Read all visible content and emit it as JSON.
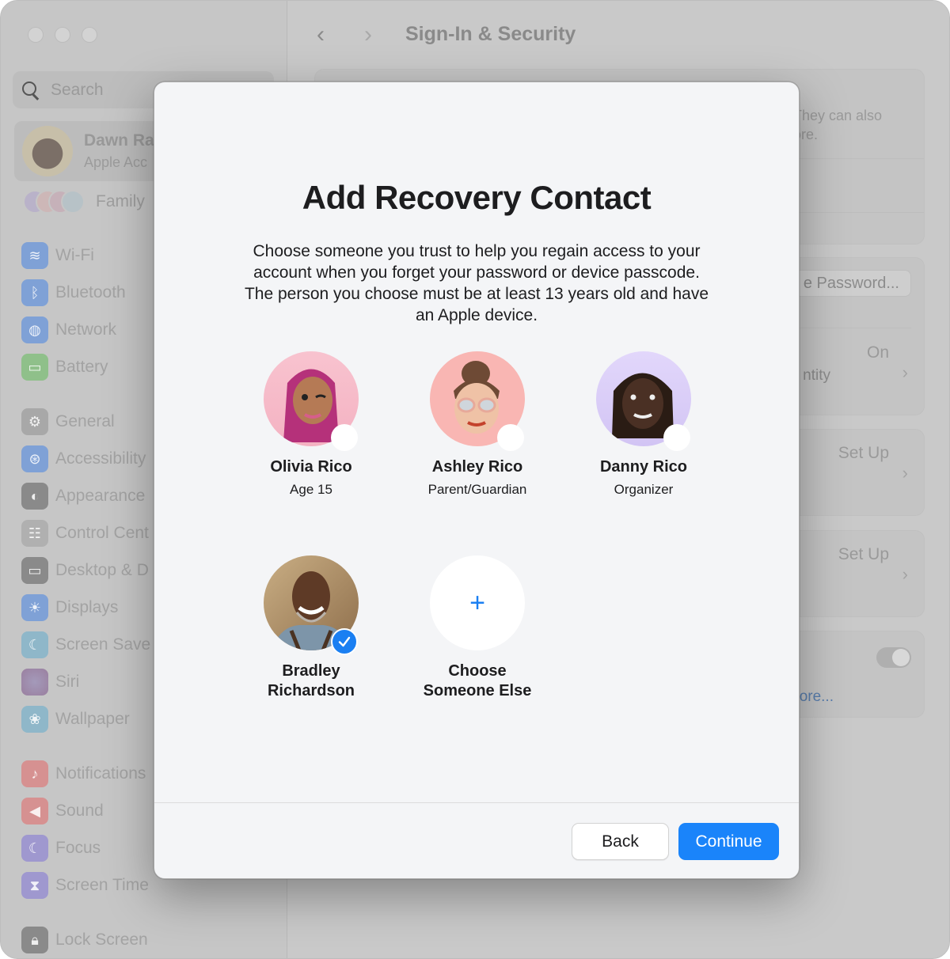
{
  "window": {
    "traffic_lights": [
      "close",
      "minimize",
      "zoom"
    ]
  },
  "sidebar": {
    "search_placeholder": "Search",
    "account": {
      "name": "Dawn Ra",
      "subtitle": "Apple Acc"
    },
    "family_label": "Family",
    "items": [
      {
        "label": "Wi-Fi",
        "icon": "wifi-icon",
        "color": "#7fa1d6"
      },
      {
        "label": "Bluetooth",
        "icon": "bluetooth-icon",
        "color": "#7fa1d6"
      },
      {
        "label": "Network",
        "icon": "globe-icon",
        "color": "#7fa1d6"
      },
      {
        "label": "Battery",
        "icon": "battery-icon",
        "color": "#8fc08a"
      },
      {
        "label": "General",
        "icon": "gear-icon",
        "color": "#a8a8a8"
      },
      {
        "label": "Accessibility",
        "icon": "accessibility-icon",
        "color": "#7fa1d6"
      },
      {
        "label": "Appearance",
        "icon": "appearance-icon",
        "color": "#8a8a8a"
      },
      {
        "label": "Control Cent",
        "icon": "control-center-icon",
        "color": "#b0b0b0"
      },
      {
        "label": "Desktop & D",
        "icon": "desktop-dock-icon",
        "color": "#8a8a8a"
      },
      {
        "label": "Displays",
        "icon": "sun-icon",
        "color": "#7fa1d6"
      },
      {
        "label": "Screen Save",
        "icon": "screen-saver-icon",
        "color": "#8fb7c9"
      },
      {
        "label": "Siri",
        "icon": "siri-icon",
        "color": "#9a7f9f"
      },
      {
        "label": "Wallpaper",
        "icon": "flower-icon",
        "color": "#8fb7c9"
      },
      {
        "label": "Notifications",
        "icon": "bell-icon",
        "color": "#d69191"
      },
      {
        "label": "Sound",
        "icon": "speaker-icon",
        "color": "#d69191"
      },
      {
        "label": "Focus",
        "icon": "moon-icon",
        "color": "#9f98cf"
      },
      {
        "label": "Screen Time",
        "icon": "hourglass-icon",
        "color": "#9f98cf"
      },
      {
        "label": "Lock Screen",
        "icon": "lock-icon",
        "color": "#8a8a8a"
      }
    ]
  },
  "main": {
    "title": "Sign-In & Security",
    "card1_text": "They can also\nore.",
    "password_button": "e Password...",
    "identity_status": "On",
    "identity_label": "ntity",
    "setup_1": "Set Up",
    "setup_2": "Set Up",
    "learn_more": "ore..."
  },
  "modal": {
    "title": "Add Recovery Contact",
    "description": "Choose someone you trust to help you regain access to your account when you forget your password or device passcode. The person you choose must be at least 13 years old and have an Apple device.",
    "contacts": [
      {
        "name": "Olivia Rico",
        "role": "Age 15",
        "selected": false,
        "bg": "#f8c3cf"
      },
      {
        "name": "Ashley Rico",
        "role": "Parent/Guardian",
        "selected": false,
        "bg": "#f9b6b3"
      },
      {
        "name": "Danny Rico",
        "role": "Organizer",
        "selected": false,
        "bg": "#d9ccf7"
      },
      {
        "name": "Bradley Richardson",
        "role": "",
        "selected": true,
        "bg": "#b79a72"
      }
    ],
    "choose_else": {
      "label": "Choose Someone Else",
      "icon": "+"
    },
    "back_label": "Back",
    "continue_label": "Continue",
    "accent_color": "#1a84fa"
  }
}
